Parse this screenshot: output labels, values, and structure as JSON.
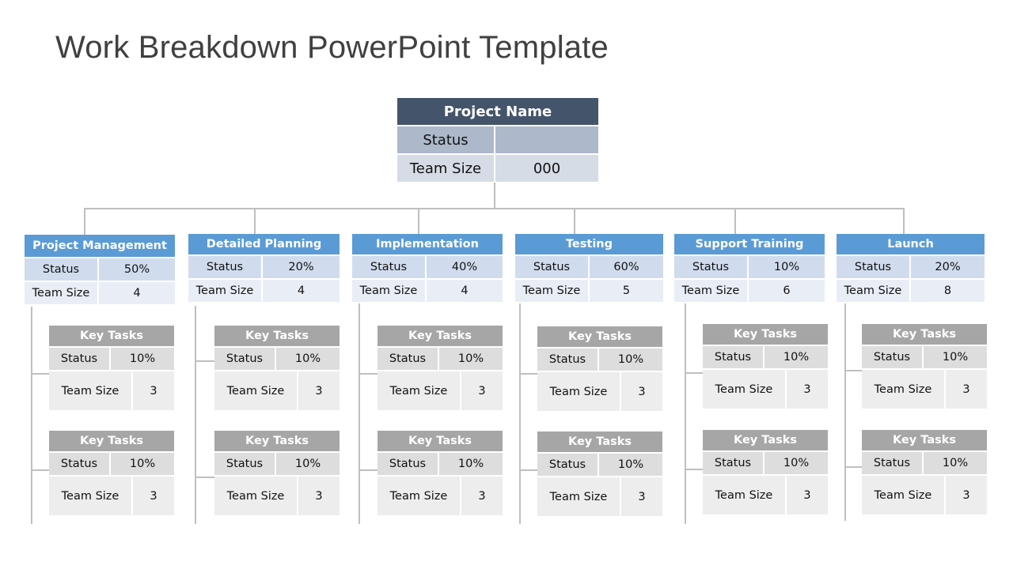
{
  "title": "Work Breakdown PowerPoint Template",
  "colors": {
    "root_header": "#44546A",
    "root_status": "#ADB9CA",
    "root_team": "#D6DCE5",
    "phase_header": "#5B9BD5",
    "phase_status": "#D0DCEE",
    "phase_team": "#E9EEF6",
    "task_header": "#A6A6A6",
    "task_status": "#DDDDDD",
    "task_team": "#EDEDED",
    "connector": "#BFBFBF",
    "title_text": "#404040"
  },
  "root": {
    "name": "Project Name",
    "status_label": "Status",
    "status_value": "",
    "team_label": "Team Size",
    "team_value": "000"
  },
  "phases": [
    {
      "name": "Project Management",
      "status_label": "Status",
      "status_value": "50%",
      "team_label": "Team Size",
      "team_value": "4",
      "tasks": [
        {
          "name": "Key Tasks",
          "status_label": "Status",
          "status_value": "10%",
          "team_label": "Team Size",
          "team_value": "3"
        },
        {
          "name": "Key Tasks",
          "status_label": "Status",
          "status_value": "10%",
          "team_label": "Team Size",
          "team_value": "3"
        }
      ]
    },
    {
      "name": "Detailed Planning",
      "status_label": "Status",
      "status_value": "20%",
      "team_label": "Team Size",
      "team_value": "4",
      "tasks": [
        {
          "name": "Key Tasks",
          "status_label": "Status",
          "status_value": "10%",
          "team_label": "Team Size",
          "team_value": "3"
        },
        {
          "name": "Key Tasks",
          "status_label": "Status",
          "status_value": "10%",
          "team_label": "Team Size",
          "team_value": "3"
        }
      ]
    },
    {
      "name": "Implementation",
      "status_label": "Status",
      "status_value": "40%",
      "team_label": "Team Size",
      "team_value": "4",
      "tasks": [
        {
          "name": "Key Tasks",
          "status_label": "Status",
          "status_value": "10%",
          "team_label": "Team Size",
          "team_value": "3"
        },
        {
          "name": "Key Tasks",
          "status_label": "Status",
          "status_value": "10%",
          "team_label": "Team Size",
          "team_value": "3"
        }
      ]
    },
    {
      "name": "Testing",
      "status_label": "Status",
      "status_value": "60%",
      "team_label": "Team Size",
      "team_value": "5",
      "tasks": [
        {
          "name": "Key Tasks",
          "status_label": "Status",
          "status_value": "10%",
          "team_label": "Team Size",
          "team_value": "3"
        },
        {
          "name": "Key Tasks",
          "status_label": "Status",
          "status_value": "10%",
          "team_label": "Team Size",
          "team_value": "3"
        }
      ]
    },
    {
      "name": "Support Training",
      "status_label": "Status",
      "status_value": "10%",
      "team_label": "Team Size",
      "team_value": "6",
      "tasks": [
        {
          "name": "Key Tasks",
          "status_label": "Status",
          "status_value": "10%",
          "team_label": "Team Size",
          "team_value": "3"
        },
        {
          "name": "Key Tasks",
          "status_label": "Status",
          "status_value": "10%",
          "team_label": "Team Size",
          "team_value": "3"
        }
      ]
    },
    {
      "name": "Launch",
      "status_label": "Status",
      "status_value": "20%",
      "team_label": "Team Size",
      "team_value": "8",
      "tasks": [
        {
          "name": "Key Tasks",
          "status_label": "Status",
          "status_value": "10%",
          "team_label": "Team Size",
          "team_value": "3"
        },
        {
          "name": "Key Tasks",
          "status_label": "Status",
          "status_value": "10%",
          "team_label": "Team Size",
          "team_value": "3"
        }
      ]
    }
  ]
}
